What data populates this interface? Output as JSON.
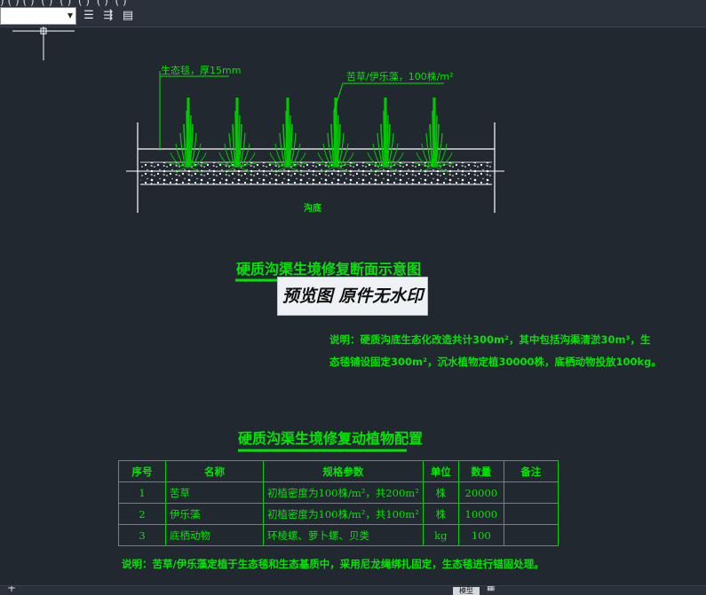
{
  "toolbar": {
    "menu_strip": ") ( ) ( )  ( )  ( )  ( )  ( )  ( )",
    "layer_value": "",
    "layer_match_icon": "layer-match-icon",
    "layer_prev_icon": "layer-previous-icon",
    "layer_state_icon": "layer-state-icon"
  },
  "section": {
    "label_mat": "生态毯，厚15mm",
    "label_plants": "苦草/伊乐藻，100株/m²",
    "label_bottom": "沟底",
    "title": "硬质沟渠生境修复断面示意图",
    "note_line1": "说明：硬质沟底生态化改造共计300m²，其中包括沟渠清淤30m³，生",
    "note_line2": "态毯铺设固定300m²，沉水植物定植30000株，底栖动物投放100kg。"
  },
  "watermark": "预览图 原件无水印",
  "table": {
    "title": "硬质沟渠生境修复动植物配置",
    "headers": [
      "序号",
      "名称",
      "规格参数",
      "单位",
      "数量",
      "备注"
    ],
    "rows": [
      [
        "1",
        "苦草",
        "初植密度为100株/m²，共200m²",
        "株",
        "20000",
        ""
      ],
      [
        "2",
        "伊乐藻",
        "初植密度为100株/m²，共100m²",
        "株",
        "10000",
        ""
      ],
      [
        "3",
        "底栖动物",
        "环棱螺、萝卜螺、贝类",
        "kg",
        "100",
        ""
      ]
    ],
    "note": "说明：苦草/伊乐藻定植于生态毯和生态基质中，采用尼龙绳绑扎固定，生态毯进行锚固处理。"
  },
  "statusbar": {
    "add_icon": "plus-icon",
    "model_label": "模型",
    "grid_icon": "grid-icon"
  },
  "colors": {
    "background": "#212830",
    "cad_green": "#00e600",
    "line_white": "#ffffff"
  }
}
